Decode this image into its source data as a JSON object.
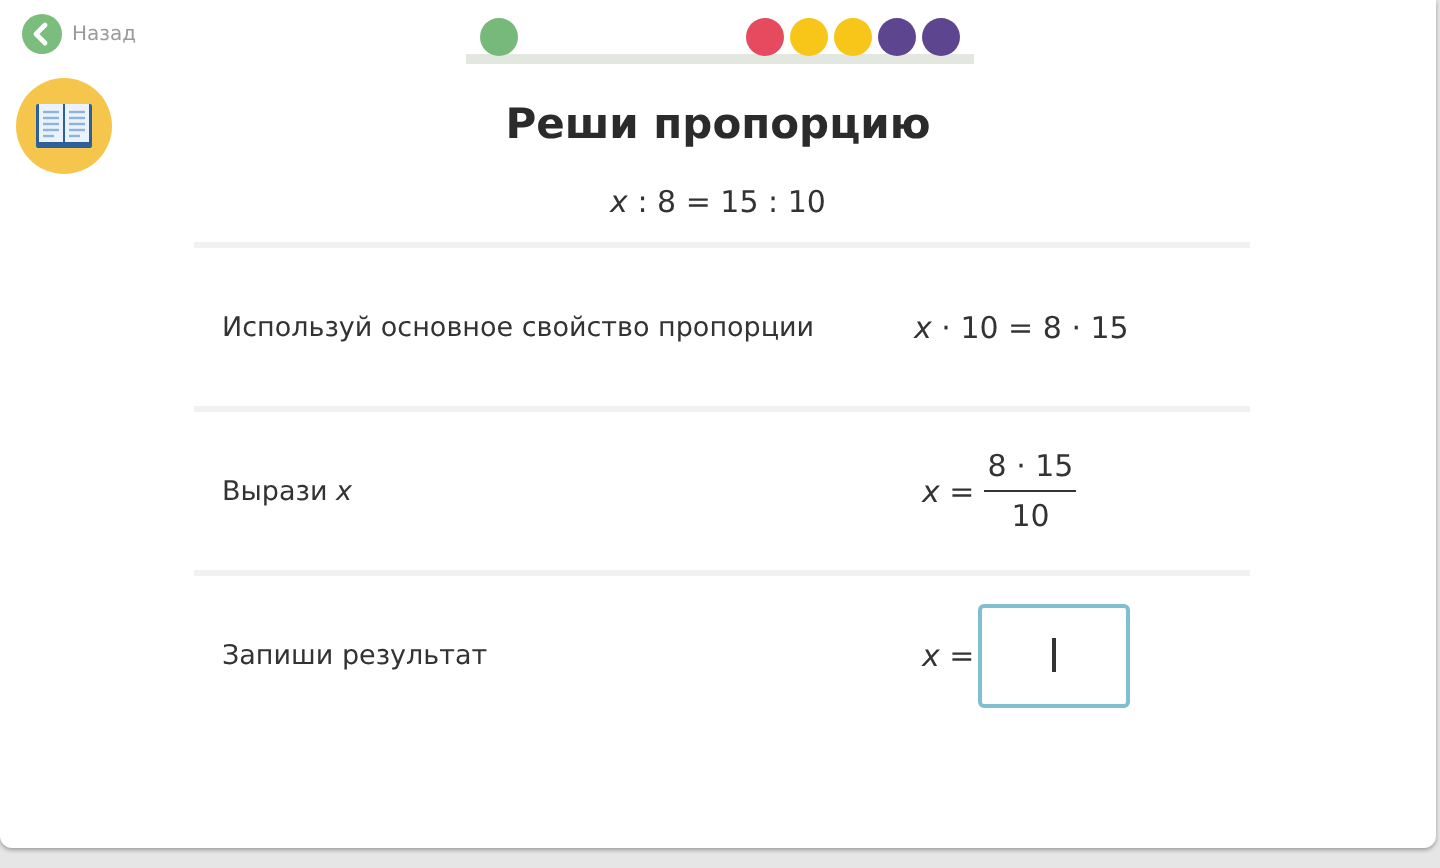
{
  "back_link": {
    "label": "Назад"
  },
  "progress": {
    "done_dots": [
      {
        "color": "#77b97a"
      }
    ],
    "upcoming_dots": [
      {
        "color": "#e64a5e"
      },
      {
        "color": "#f7c619"
      },
      {
        "color": "#f7c619"
      },
      {
        "color": "#5e4590"
      },
      {
        "color": "#5e4590"
      }
    ]
  },
  "title": "Реши пропорцию",
  "equation": "*x* : 8 = 15 : 10",
  "steps": [
    {
      "kind": "text",
      "label": "Используй основное свойство пропорции",
      "expression": "*x* · 10 = 8 · 15"
    },
    {
      "kind": "fraction",
      "label": "Вырази *x*",
      "lhs": "*x* =",
      "numerator": "8 · 15",
      "denominator": "10"
    },
    {
      "kind": "input",
      "label": "Запиши результат",
      "lhs": "*x* ="
    }
  ]
}
